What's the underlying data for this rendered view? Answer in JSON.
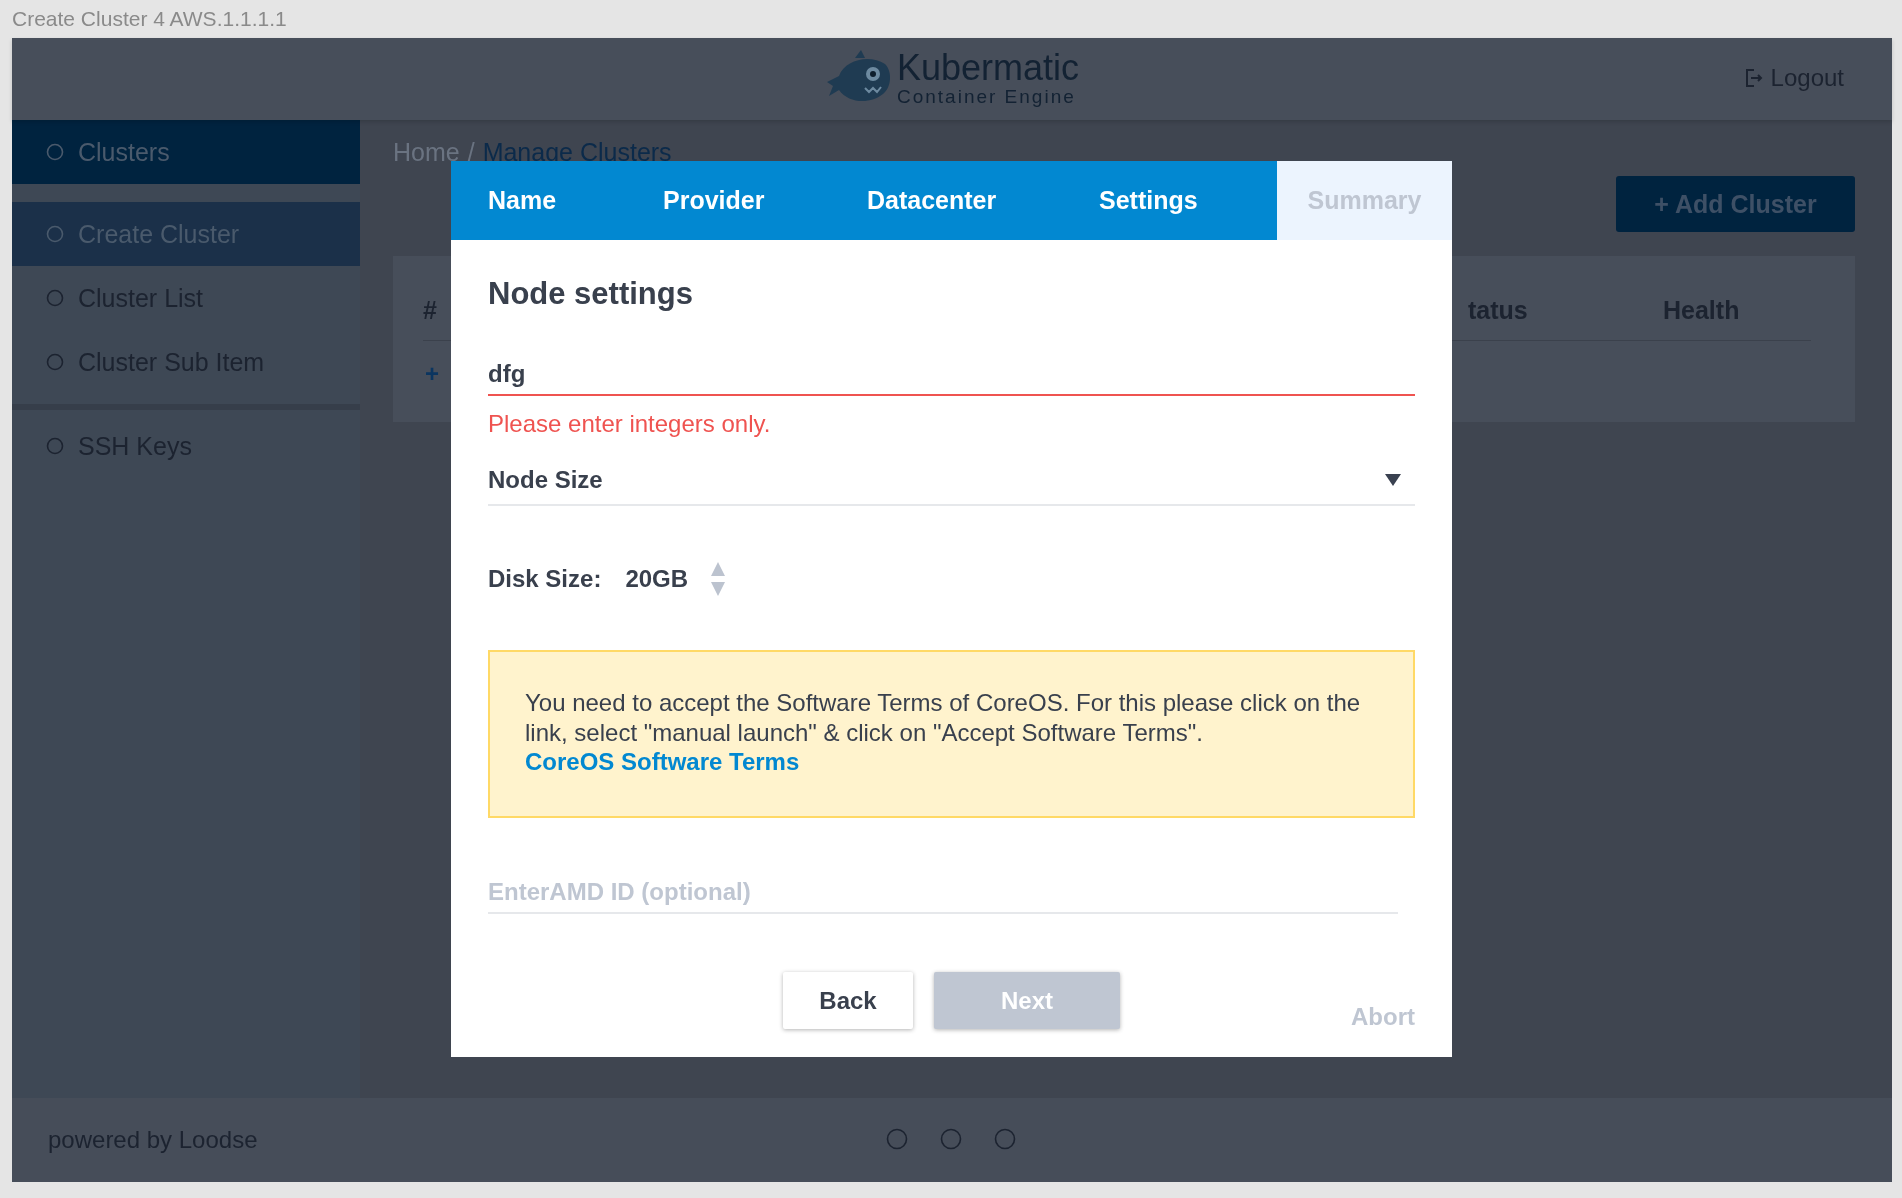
{
  "window": {
    "title": "Create Cluster 4 AWS.1.1.1.1"
  },
  "header": {
    "logo_title": "Kubermatic",
    "logo_subtitle": "Container Engine",
    "logout": "Logout"
  },
  "sidebar": {
    "items": [
      {
        "label": "Clusters",
        "kind": "section",
        "selected": true
      },
      {
        "label": "Create Cluster",
        "kind": "subitem",
        "selected": true
      },
      {
        "label": "Cluster List",
        "kind": "subitem",
        "selected": false
      },
      {
        "label": "Cluster Sub Item",
        "kind": "subitem",
        "selected": false
      },
      {
        "label": "SSH Keys",
        "kind": "section",
        "selected": false
      }
    ]
  },
  "breadcrumb": {
    "home": "Home",
    "separator": "/",
    "current": "Manage Clusters"
  },
  "add_button": "+ Add Cluster",
  "table": {
    "columns": [
      "#",
      "tatus",
      "Health"
    ],
    "add_link": "+"
  },
  "footer": {
    "text": "powered by Loodse"
  },
  "dialog": {
    "tabs": [
      {
        "label": "Name",
        "disabled": false
      },
      {
        "label": "Provider",
        "disabled": false
      },
      {
        "label": "Datacenter",
        "disabled": false
      },
      {
        "label": "Settings",
        "disabled": false
      },
      {
        "label": "Summary",
        "disabled": true
      }
    ],
    "title": "Node settings",
    "node_count": {
      "value": "dfg",
      "error": "Please enter integers only."
    },
    "node_size": {
      "placeholder": "Node Size"
    },
    "disk_size": {
      "label": "Disk Size:",
      "value": "20GB"
    },
    "notice": {
      "text": "You need to accept the Software Terms of CoreOS. For this please click on the link, select \"manual launch\" & click on \"Accept Software Terms\".",
      "link": "CoreOS Software Terms"
    },
    "ami": {
      "placeholder": "EnterAMD ID (optional)"
    },
    "buttons": [
      {
        "label": "Back",
        "disabled": false
      },
      {
        "label": "Next",
        "disabled": true
      }
    ],
    "abort": "Abort"
  }
}
